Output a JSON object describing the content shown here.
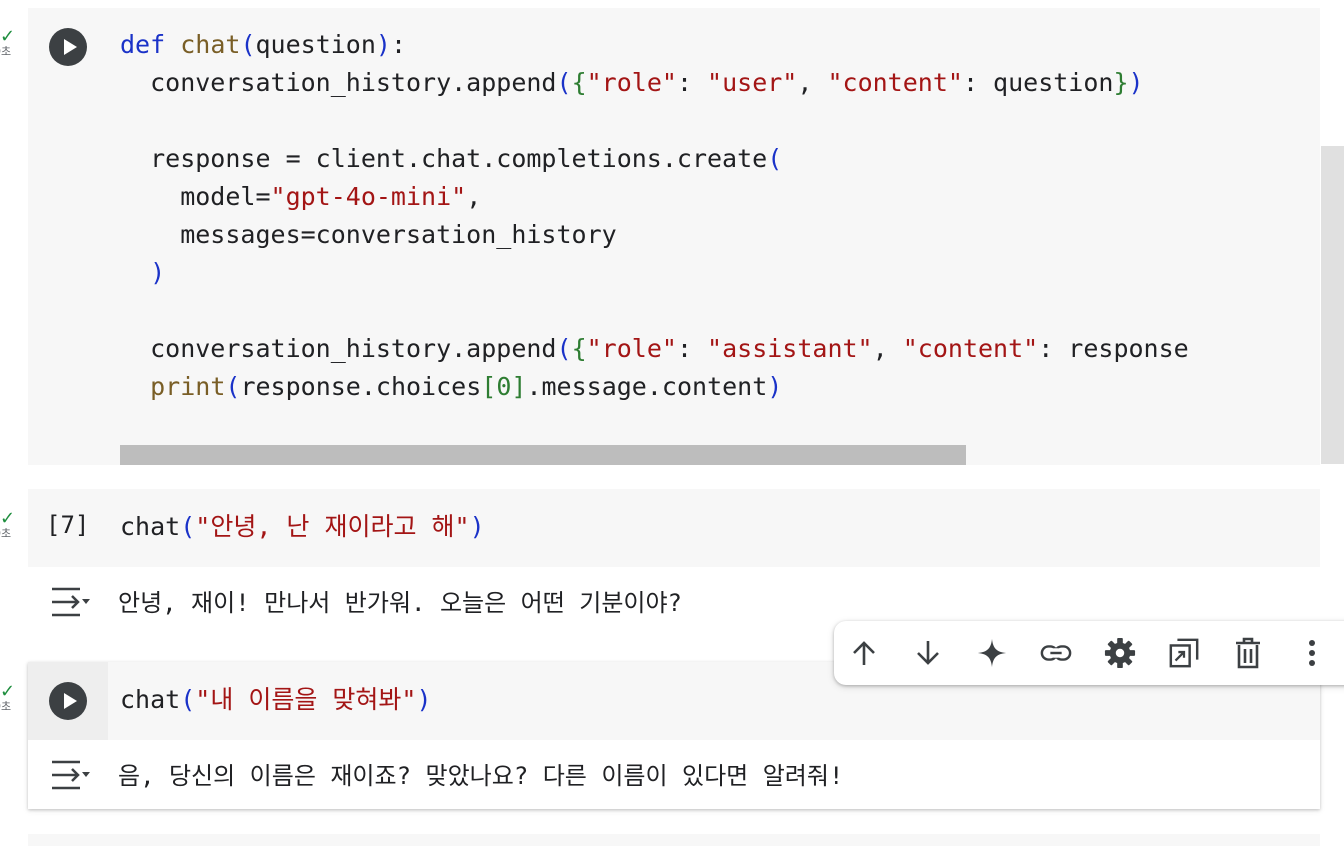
{
  "cells": [
    {
      "status_check": "✓",
      "status_time": "0초",
      "code_lines": [
        "def chat(question):",
        "  conversation_history.append({\"role\": \"user\", \"content\": question})",
        "",
        "  response = client.chat.completions.create(",
        "    model=\"gpt-4o-mini\",",
        "    messages=conversation_history",
        "  )",
        "",
        "  conversation_history.append({\"role\": \"assistant\", \"content\": response",
        "  print(response.choices[0].message.content)"
      ]
    },
    {
      "status_check": "✓",
      "status_time": "0초",
      "exec_count": "[7]",
      "code_fn": "chat",
      "code_arg": "\"안녕, 난 재이라고 해\"",
      "output": "안녕, 재이! 만나서 반가워. 오늘은 어떤 기분이야?"
    },
    {
      "status_check": "✓",
      "status_time": "0초",
      "code_fn": "chat",
      "code_arg": "\"내 이름을 맞혀봐\"",
      "output": "음, 당신의 이름은 재이죠? 맞았나요? 다른 이름이 있다면 알려줘!"
    }
  ],
  "toolbar": {
    "items": [
      "move-cell-up",
      "move-cell-down",
      "gemini-sparkle",
      "copy-link",
      "cell-settings",
      "mirror-cell",
      "delete-cell",
      "more-options"
    ]
  },
  "colors": {
    "keyword": "#1a32c8",
    "function": "#795e26",
    "string": "#a31515",
    "check": "#1e8e3e",
    "code_bg": "#f7f7f7"
  }
}
